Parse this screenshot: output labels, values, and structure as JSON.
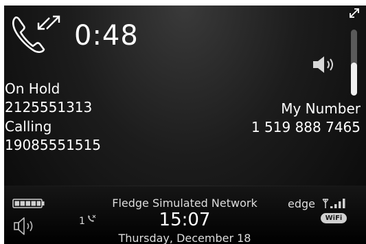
{
  "call": {
    "timer": "0:48",
    "on_hold_label": "On Hold",
    "on_hold_number": "2125551313",
    "calling_label": "Calling",
    "calling_number": "19085551515",
    "my_number_label": "My Number",
    "my_number_value": "1 519 888 7465",
    "volume_level": 0.5
  },
  "status_bar": {
    "network_name": "Fledge Simulated Network",
    "clock": "15:07",
    "date": "Thursday, December 18",
    "network_type": "edge",
    "wifi_label": "WiFi",
    "missed_call_count": "1",
    "battery_level": 1.0
  },
  "icons": {
    "call": "phone-swap-icon",
    "expand": "expand-icon",
    "speaker": "speaker-icon",
    "battery": "battery-icon",
    "ringer": "ringer-volume-icon",
    "missed_call": "missed-call-icon",
    "signal": "signal-strength-icon"
  },
  "colors": {
    "background": "#1c1c1c",
    "text": "#ffffff",
    "secondary_text": "#dddddd",
    "volume_track": "#5a5a5a",
    "volume_fill": "#f0f0f0"
  }
}
